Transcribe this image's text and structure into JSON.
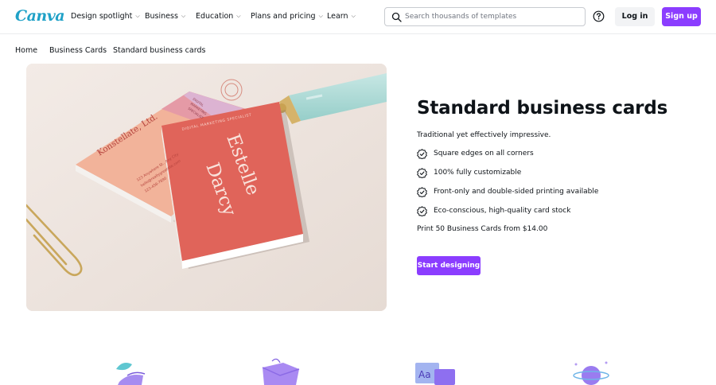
{
  "header": {
    "logo": "Canva",
    "nav": [
      {
        "label": "Design spotlight"
      },
      {
        "label": "Business"
      },
      {
        "label": "Education"
      },
      {
        "label": "Plans and pricing"
      },
      {
        "label": "Learn"
      }
    ],
    "search": {
      "placeholder": "Search thousands of templates",
      "value": ""
    },
    "login_label": "Log in",
    "signup_label": "Sign up"
  },
  "breadcrumb": [
    "Home",
    "Business Cards",
    "Standard business cards"
  ],
  "hero": {
    "card_back": {
      "company": "Konstellate, Ltd.",
      "address_lines": [
        "123 Anywhere St., Any City",
        "hello@reallygreatsite.com",
        "123-456-7890"
      ],
      "tag_lines": [
        "DIGITAL",
        "MARKETING",
        "SPECIALIST"
      ]
    },
    "card_front": {
      "role": "DIGITAL MARKETING SPECIALIST",
      "name_first": "Estelle",
      "name_last": "Darcy"
    }
  },
  "product": {
    "title": "Standard business cards",
    "subtitle": "Traditional yet effectively impressive.",
    "features": [
      "Square edges on all corners",
      "100% fully customizable",
      "Front-only and double-sided printing available",
      "Eco-conscious, high-quality card stock"
    ],
    "price_text": "Print 50 Business Cards from $14.00",
    "cta_label": "Start designing"
  },
  "colors": {
    "brand_purple": "#8b3dff",
    "logo_blue": "#1fa1c7",
    "card_red": "#e0645a",
    "card_peach": "#f2b39a"
  },
  "icons": {
    "search": "search-icon",
    "help": "help-circle-icon",
    "feature": "checkmark-badge-icon",
    "chevron": "chevron-down-icon"
  }
}
